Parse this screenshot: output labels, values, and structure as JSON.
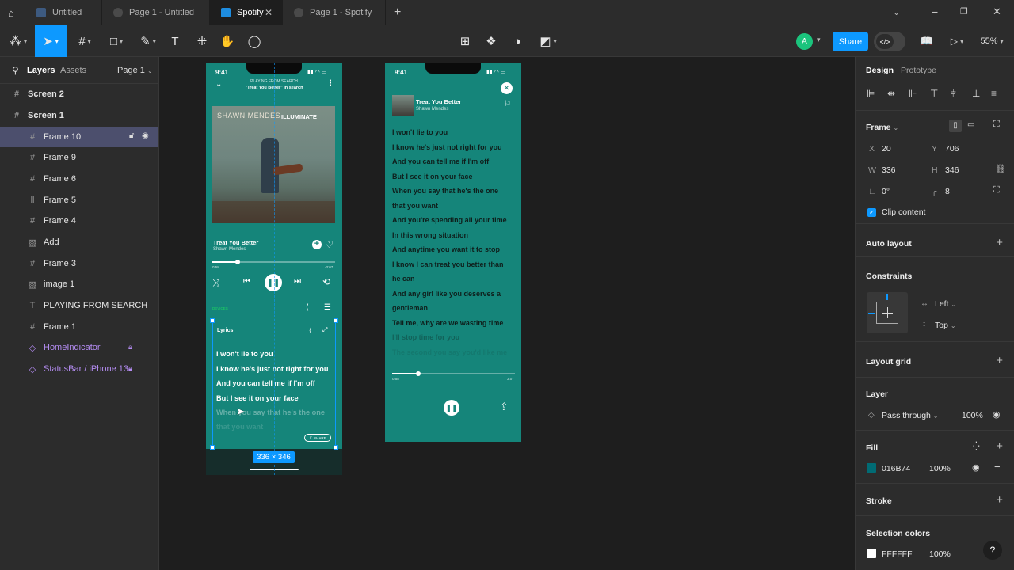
{
  "tabs": [
    {
      "label": "Untitled",
      "active": false
    },
    {
      "label": "Page 1 - Untitled",
      "active": false
    },
    {
      "label": "Spotify",
      "active": true
    },
    {
      "label": "Page 1 - Spotify",
      "active": false
    }
  ],
  "toolbar": {
    "share_label": "Share",
    "zoom": "55%",
    "avatar_initial": "A"
  },
  "left_panel": {
    "tab_layers": "Layers",
    "tab_assets": "Assets",
    "page": "Page 1",
    "layers": [
      {
        "label": "Screen 2",
        "icon": "hash"
      },
      {
        "label": "Screen 1",
        "icon": "hash"
      },
      {
        "label": "Frame 10",
        "icon": "hash"
      },
      {
        "label": "Frame 9",
        "icon": "hash"
      },
      {
        "label": "Frame 6",
        "icon": "hash"
      },
      {
        "label": "Frame 5",
        "icon": "columns"
      },
      {
        "label": "Frame 4",
        "icon": "hash"
      },
      {
        "label": "Add",
        "icon": "image"
      },
      {
        "label": "Frame 3",
        "icon": "hash"
      },
      {
        "label": "image 1",
        "icon": "image"
      },
      {
        "label": "PLAYING FROM SEARCH",
        "icon": "text"
      },
      {
        "label": "Frame 1",
        "icon": "hash"
      },
      {
        "label": "HomeIndicator",
        "icon": "component"
      },
      {
        "label": "StatusBar / iPhone 13",
        "icon": "component"
      }
    ]
  },
  "right_panel": {
    "tab_design": "Design",
    "tab_prototype": "Prototype",
    "frame_label": "Frame",
    "x_label": "X",
    "x": "20",
    "y_label": "Y",
    "y": "706",
    "w_label": "W",
    "w": "336",
    "h_label": "H",
    "h": "346",
    "rotation": "0°",
    "radius": "8",
    "clip_content": "Clip content",
    "auto_layout": "Auto layout",
    "constraints": "Constraints",
    "constraint_h": "Left",
    "constraint_v": "Top",
    "layout_grid": "Layout grid",
    "layer": "Layer",
    "blend": "Pass through",
    "layer_opacity": "100%",
    "fill": "Fill",
    "fill_hex": "016B74",
    "fill_opacity": "100%",
    "fill_color": "#016b74",
    "stroke": "Stroke",
    "selection_colors": "Selection colors",
    "sel_hex": "FFFFFF",
    "sel_opacity": "100%",
    "help": "?"
  },
  "screen1": {
    "time": "9:41",
    "playing_from": "PLAYING FROM SEARCH",
    "search_query": "\"Treat You Better\" in search",
    "album_artist": "SHAWN MENDES",
    "album_title": "ILLUMINATE",
    "song": "Treat You Better",
    "artist": "Shawn Mendes",
    "elapsed": "0:58",
    "remaining": "-3:07",
    "device": "DEVICES",
    "lyrics_title": "Lyrics",
    "share_btn": "SHARE",
    "lyrics": [
      "I won't lie to you",
      "I know he's just not right for you",
      "And you can tell me if I'm off",
      "But I see it on your face",
      "When you say that he's the one",
      "that you want"
    ],
    "size_badge": "336 × 346",
    "teal": "#15857a"
  },
  "screen2": {
    "time": "9:41",
    "song": "Treat You Better",
    "artist": "Shawn Mendes",
    "lyrics": [
      "I won't lie to you",
      "I know he's just not right for you",
      "And you can tell me if I'm off",
      "But I see it on your face",
      "When you say that he's the one",
      "that you want",
      "And you're spending all your time",
      "In this wrong situation",
      "And anytime you want it to stop",
      "I know I can treat you better than",
      "he can",
      "And any girl like you deserves a",
      "gentleman",
      "Tell me, why are we wasting time",
      "I'll stop time for you",
      "The second you say you'd like me"
    ],
    "elapsed": "0:58",
    "remaining": "3:07"
  }
}
